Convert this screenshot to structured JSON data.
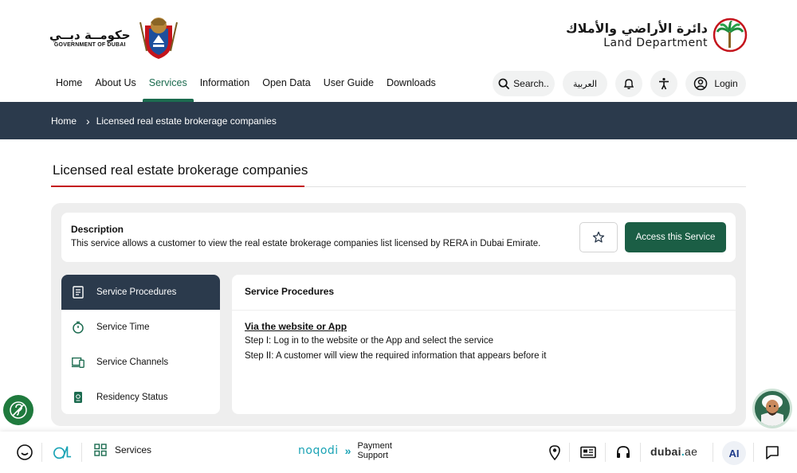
{
  "header": {
    "gov_logo": {
      "ar": "حكومــة دبــي",
      "en": "GOVERNMENT OF DUBAI"
    },
    "ld_logo": {
      "ar": "دائرة الأراضي والأملاك",
      "en": "Land Department"
    },
    "nav": [
      {
        "label": "Home",
        "active": false
      },
      {
        "label": "About Us",
        "active": false
      },
      {
        "label": "Services",
        "active": true
      },
      {
        "label": "Information",
        "active": false
      },
      {
        "label": "Open Data",
        "active": false
      },
      {
        "label": "User Guide",
        "active": false
      },
      {
        "label": "Downloads",
        "active": false
      }
    ],
    "search_label": "Search..",
    "language_label": "العربية",
    "login_label": "Login"
  },
  "breadcrumb": {
    "home": "Home",
    "current": "Licensed real estate brokerage companies"
  },
  "page": {
    "title": "Licensed real estate brokerage companies",
    "description_heading": "Description",
    "description_text": "This service allows a customer to view the real estate brokerage companies list licensed by RERA in Dubai Emirate.",
    "access_button": "Access this Service"
  },
  "side_menu": [
    {
      "label": "Service Procedures",
      "icon": "document-list-icon",
      "active": true
    },
    {
      "label": "Service Time",
      "icon": "stopwatch-icon",
      "active": false
    },
    {
      "label": "Service Channels",
      "icon": "devices-icon",
      "active": false
    },
    {
      "label": "Residency Status",
      "icon": "passport-icon",
      "active": false
    }
  ],
  "content": {
    "heading": "Service Procedures",
    "channel_title": "Via the website or App",
    "steps": [
      "Step I: Log in to the website or the App and select the service",
      "Step II: A customer will view the required information that appears before it"
    ]
  },
  "bottom_bar": {
    "services_label": "Services",
    "noqodi_word": "noqodi",
    "noqodi_label_1": "Payment",
    "noqodi_label_2": "Support",
    "dubai_ae": {
      "main": "dubai",
      "dot": ".",
      "suffix": "ae"
    },
    "ai_label": "AI"
  },
  "colors": {
    "primary_green": "#1b6b4f",
    "dark_navy": "#2b3a4c",
    "accent_red": "#c4141c",
    "noqodi_teal": "#1aa3b5"
  }
}
